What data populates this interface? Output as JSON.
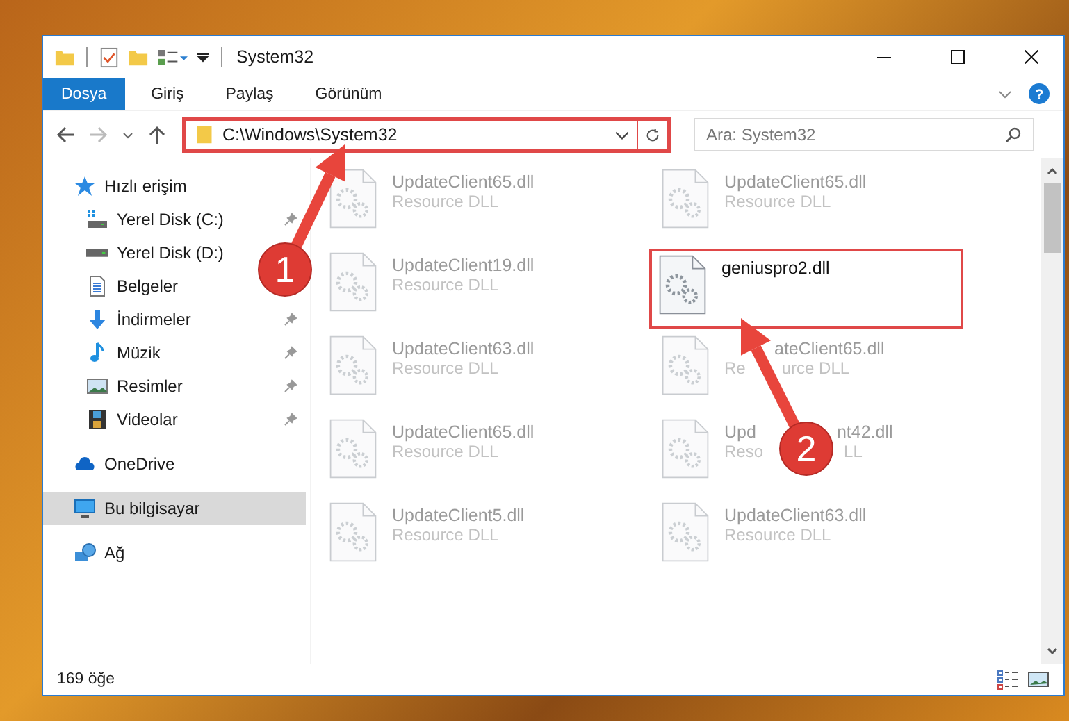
{
  "window": {
    "title": "System32"
  },
  "ribbon_tabs": [
    {
      "label": "Dosya",
      "selected": true
    },
    {
      "label": "Giriş",
      "selected": false
    },
    {
      "label": "Paylaş",
      "selected": false
    },
    {
      "label": "Görünüm",
      "selected": false
    }
  ],
  "address": {
    "path": "C:\\Windows\\System32",
    "highlighted": true
  },
  "search": {
    "placeholder": "Ara: System32"
  },
  "help_button": "?",
  "navigation": [
    {
      "label": "Hızlı erişim",
      "kind": "star",
      "selected": false,
      "children": [
        {
          "label": "Yerel Disk (C:)",
          "kind": "system-drive",
          "pinned": true,
          "selected": false
        },
        {
          "label": "Yerel Disk (D:)",
          "kind": "drive",
          "pinned": false,
          "selected": false
        },
        {
          "label": "Belgeler",
          "kind": "documents",
          "pinned": false,
          "selected": false
        },
        {
          "label": "İndirmeler",
          "kind": "download",
          "pinned": true,
          "selected": false
        },
        {
          "label": "Müzik",
          "kind": "music",
          "pinned": true,
          "selected": false
        },
        {
          "label": "Resimler",
          "kind": "pictures",
          "pinned": true,
          "selected": false
        },
        {
          "label": "Videolar",
          "kind": "videos",
          "pinned": true,
          "selected": false
        }
      ]
    },
    {
      "label": "OneDrive",
      "kind": "cloud",
      "selected": false
    },
    {
      "label": "Bu bilgisayar",
      "kind": "computer",
      "selected": true
    },
    {
      "label": "Ağ",
      "kind": "network",
      "selected": false
    }
  ],
  "files": [
    {
      "name": "UpdateClient65.dll",
      "type": "Resource DLL",
      "faded": true,
      "highlighted": false
    },
    {
      "name": "UpdateClient65.dll",
      "type": "Resource DLL",
      "faded": true,
      "highlighted": false
    },
    {
      "name": "UpdateClient19.dll",
      "type": "Resource DLL",
      "faded": true,
      "highlighted": false
    },
    {
      "name": "geniuspro2.dll",
      "faded": false,
      "highlighted": true
    },
    {
      "name": "UpdateClient63.dll",
      "type": "Resource DLL",
      "faded": true,
      "highlighted": false
    },
    {
      "name": [
        "ateClient65.dll"
      ],
      "type": [
        "Re",
        "urce DLL"
      ],
      "faded": true,
      "highlighted": false
    },
    {
      "name": "UpdateClient65.dll",
      "type": "Resource DLL",
      "faded": true,
      "highlighted": false
    },
    {
      "name": [
        "Upd",
        "nt42.dll"
      ],
      "type": [
        "Reso",
        "LL"
      ],
      "faded": true,
      "highlighted": false
    },
    {
      "name": "UpdateClient5.dll",
      "type": "Resource DLL",
      "faded": true,
      "highlighted": false
    },
    {
      "name": "UpdateClient63.dll",
      "type": "Resource DLL",
      "faded": true,
      "highlighted": false
    }
  ],
  "status_bar": {
    "count": "169 öğe"
  },
  "annotations": [
    {
      "label": "1"
    },
    {
      "label": "2"
    }
  ]
}
